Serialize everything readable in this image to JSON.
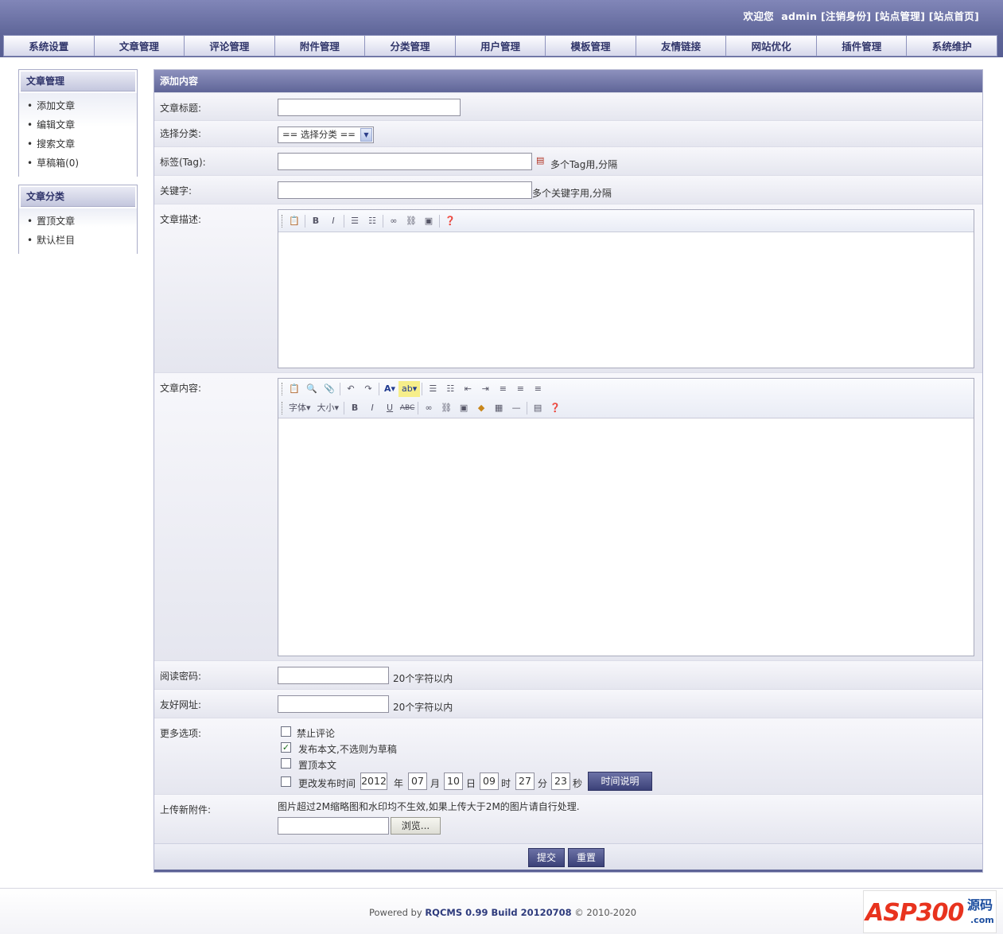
{
  "header": {
    "welcome": "欢迎您  admin",
    "logout": "[注销身份]",
    "site_admin": "[站点管理]",
    "site_home": "[站点首页]"
  },
  "nav": [
    "系统设置",
    "文章管理",
    "评论管理",
    "附件管理",
    "分类管理",
    "用户管理",
    "模板管理",
    "友情链接",
    "网站优化",
    "插件管理",
    "系统维护"
  ],
  "sidebar": {
    "article_mgmt": {
      "title": "文章管理",
      "items": [
        "添加文章",
        "编辑文章",
        "搜索文章",
        "草稿箱(0)"
      ]
    },
    "article_cat": {
      "title": "文章分类",
      "items": [
        "置顶文章",
        "默认栏目"
      ]
    }
  },
  "form": {
    "title": "添加内容",
    "article_title_label": "文章标题:",
    "category_label": "选择分类:",
    "category_value": "== 选择分类 ==",
    "tag_label": "标签(Tag):",
    "tag_hint": "多个Tag用,分隔",
    "keyword_label": "关键字:",
    "keyword_hint": "多个关键字用,分隔",
    "desc_label": "文章描述:",
    "content_label": "文章内容:",
    "font_btn": "字体",
    "size_btn": "大小",
    "password_label": "阅读密码:",
    "password_hint": "20个字符以内",
    "url_label": "友好网址:",
    "url_hint": "20个字符以内",
    "options_label": "更多选项:",
    "opt_no_comment": "禁止评论",
    "opt_publish": "发布本文,不选则为草稿",
    "opt_top": "置顶本文",
    "opt_change_time": "更改发布时间",
    "time": {
      "year": "2012",
      "year_u": "年",
      "month": "07",
      "month_u": "月",
      "day": "10",
      "day_u": "日",
      "hour": "09",
      "hour_u": "时",
      "minute": "27",
      "minute_u": "分",
      "second": "23",
      "second_u": "秒"
    },
    "time_help_btn": "时间说明",
    "upload_label": "上传新附件:",
    "upload_hint": "图片超过2M缩略图和水印均不生效,如果上传大于2M的图片请自行处理.",
    "browse_btn": "浏览...",
    "submit_btn": "提交",
    "reset_btn": "重置"
  },
  "footer": {
    "powered_prefix": "Powered by ",
    "product": "RQCMS 0.99 Build 20120708",
    "copyright": " © 2010-2020",
    "logo_main": "ASP300",
    "logo_cn": "源码",
    "logo_com": ".com"
  }
}
